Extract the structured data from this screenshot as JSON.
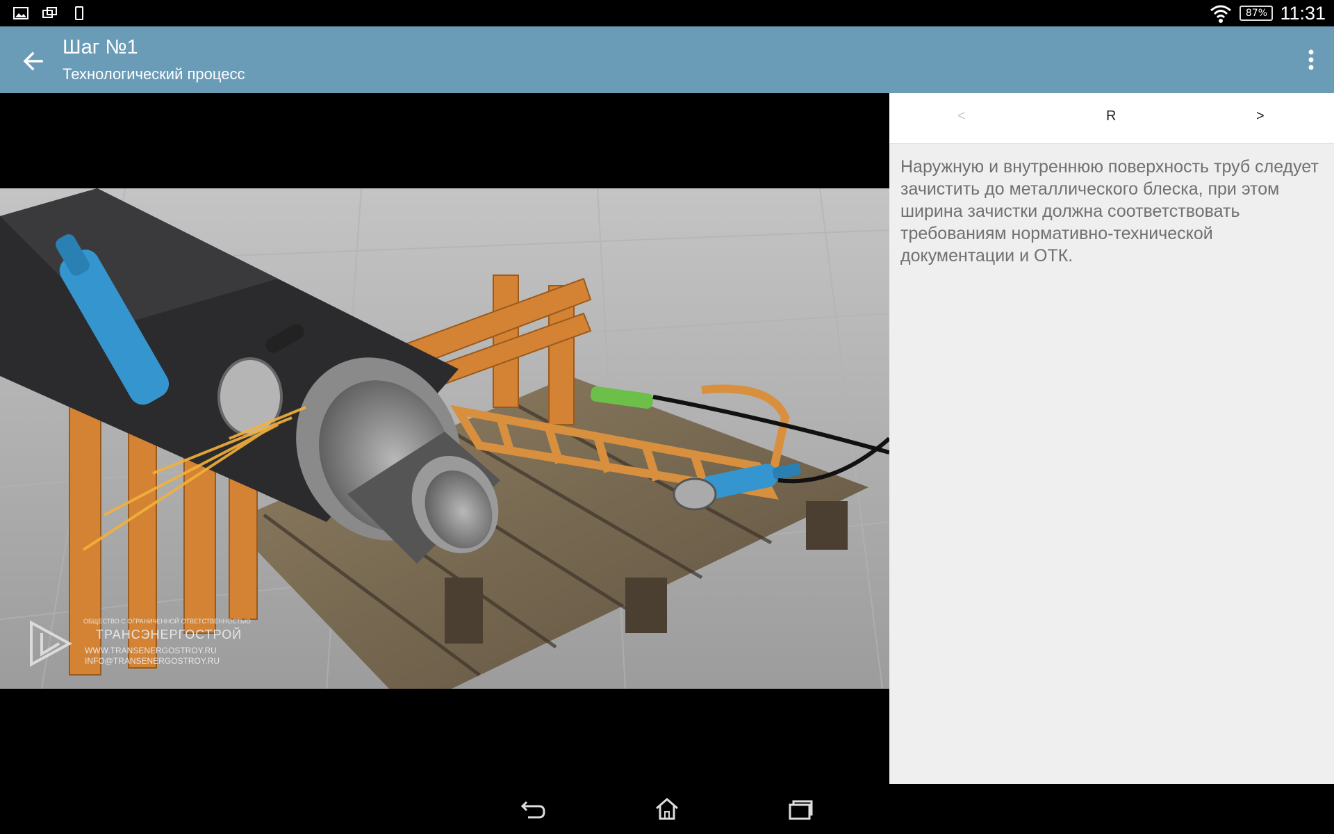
{
  "status_bar": {
    "left_icons": [
      "image-icon",
      "multi-window-icon",
      "phone-icon"
    ],
    "battery": "87%",
    "time": "11:31"
  },
  "app_bar": {
    "title": "Шаг №1",
    "subtitle": "Технологический процесс"
  },
  "video": {
    "watermark_tagline": "ОБЩЕСТВО С ОГРАНИЧЕННОЙ ОТВЕТСТВЕННОСТЬЮ",
    "watermark_company": "ТРАНСЭНЕРГОСТРОЙ",
    "watermark_site": "WWW.TRANSENERGOSTROY.RU",
    "watermark_email": "INFO@TRANSENERGOSTROY.RU"
  },
  "panel": {
    "nav": {
      "prev": "<",
      "center": "R",
      "next": ">"
    },
    "description": "Наружную и внутреннюю поверхность труб следует зачистить до металлического блеска, при этом ширина зачистки должна соответствовать требованиям нормативно-технической документации и ОТК."
  },
  "colors": {
    "app_bar": "#6a9bb7",
    "panel_bg": "#efefef",
    "text_gray": "#707070"
  }
}
